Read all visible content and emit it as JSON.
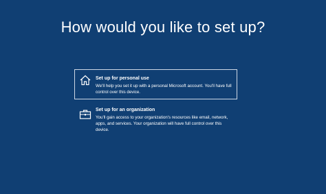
{
  "setup": {
    "heading": "How would you like to set up?",
    "options": [
      {
        "title": "Set up for personal use",
        "description": "We'll help you set it up with a personal Microsoft account. You'll have full control over this device.",
        "icon": "home-icon",
        "selected": true
      },
      {
        "title": "Set up for an organization",
        "description": "You'll gain access to your organization's resources like email, network, apps, and services. Your organization will have full control over this device.",
        "icon": "briefcase-icon",
        "selected": false
      }
    ]
  },
  "colors": {
    "background": "#103f73",
    "text": "#ffffff",
    "selection_border": "#cfd9e6"
  }
}
